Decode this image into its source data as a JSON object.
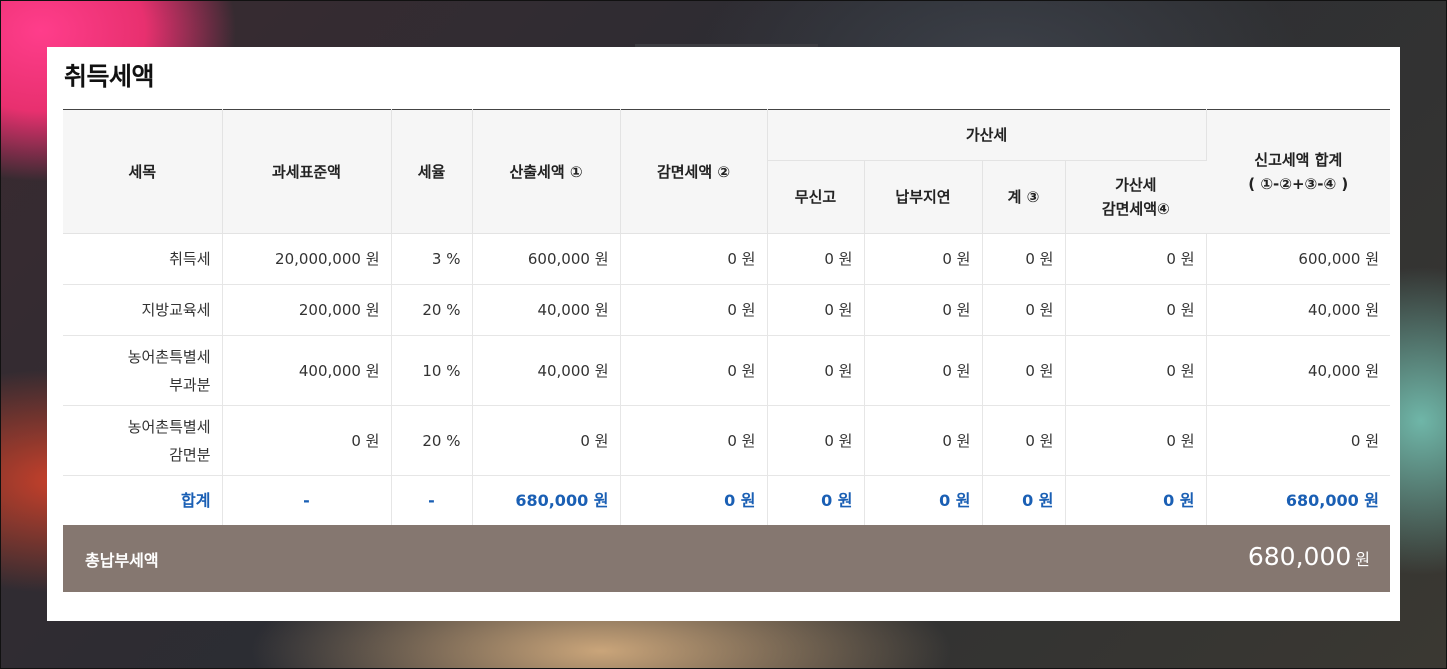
{
  "section_title": "취득세액",
  "headers": {
    "tax_item": "세목",
    "tax_base": "과세표준액",
    "rate": "세율",
    "calculated": "산출세액 ①",
    "reduction": "감면세액 ②",
    "additional_group": "가산세",
    "no_report": "무신고",
    "late_payment": "납부지연",
    "subtotal": "계 ③",
    "additional_reduction_line1": "가산세",
    "additional_reduction_line2": "감면세액④",
    "report_total_line1": "신고세액 합계",
    "report_total_line2": "( ①-②+③-④ )"
  },
  "rows": [
    {
      "item_line1": "취득세",
      "item_line2": "",
      "tax_base": "20,000,000 원",
      "rate": "3 %",
      "calculated": "600,000 원",
      "reduction": "0 원",
      "no_report": "0 원",
      "late_payment": "0 원",
      "subtotal": "0 원",
      "additional_reduction": "0 원",
      "report_total": "600,000 원"
    },
    {
      "item_line1": "지방교육세",
      "item_line2": "",
      "tax_base": "200,000 원",
      "rate": "20 %",
      "calculated": "40,000 원",
      "reduction": "0 원",
      "no_report": "0 원",
      "late_payment": "0 원",
      "subtotal": "0 원",
      "additional_reduction": "0 원",
      "report_total": "40,000 원"
    },
    {
      "item_line1": "농어촌특별세",
      "item_line2": "부과분",
      "tax_base": "400,000 원",
      "rate": "10 %",
      "calculated": "40,000 원",
      "reduction": "0 원",
      "no_report": "0 원",
      "late_payment": "0 원",
      "subtotal": "0 원",
      "additional_reduction": "0 원",
      "report_total": "40,000 원"
    },
    {
      "item_line1": "농어촌특별세",
      "item_line2": "감면분",
      "tax_base": "0 원",
      "rate": "20 %",
      "calculated": "0 원",
      "reduction": "0 원",
      "no_report": "0 원",
      "late_payment": "0 원",
      "subtotal": "0 원",
      "additional_reduction": "0 원",
      "report_total": "0 원"
    }
  ],
  "sum_row": {
    "label": "합계",
    "tax_base": "-",
    "rate": "-",
    "calculated": "680,000 원",
    "reduction": "0 원",
    "no_report": "0 원",
    "late_payment": "0 원",
    "subtotal": "0 원",
    "additional_reduction": "0 원",
    "report_total": "680,000 원"
  },
  "total_payment": {
    "label": "총납부세액",
    "amount": "680,000",
    "unit": "원"
  },
  "colors": {
    "accent_blue": "#1a5fb4",
    "total_bar": "#857770"
  }
}
